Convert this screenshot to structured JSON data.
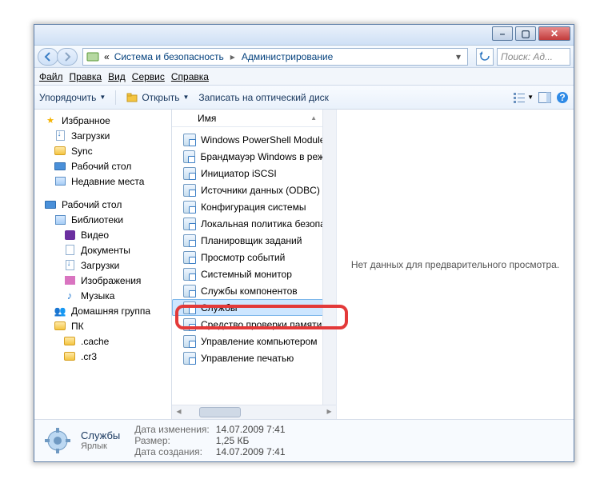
{
  "breadcrumb": {
    "level1": "Система и безопасность",
    "level2": "Администрирование"
  },
  "search": {
    "placeholder": "Поиск: Ад..."
  },
  "menu": {
    "file": "Файл",
    "edit": "Правка",
    "view": "Вид",
    "tools": "Сервис",
    "help": "Справка"
  },
  "toolbar": {
    "organize": "Упорядочить",
    "open": "Открыть",
    "burn": "Записать на оптический диск"
  },
  "nav": {
    "favorites": "Избранное",
    "downloads": "Загрузки",
    "sync": "Sync",
    "desktop": "Рабочий стол",
    "recent": "Недавние места",
    "desktop2": "Рабочий стол",
    "libraries": "Библиотеки",
    "videos": "Видео",
    "documents": "Документы",
    "downloads2": "Загрузки",
    "pictures": "Изображения",
    "music": "Музыка",
    "homegroup": "Домашняя группа",
    "pc": "ПК",
    "cache": ".cache",
    "cr3": ".cr3"
  },
  "col": {
    "name": "Имя"
  },
  "items": [
    "Windows PowerShell Modules",
    "Брандмауэр Windows в режим",
    "Инициатор iSCSI",
    "Источники данных (ODBC)",
    "Конфигурация системы",
    "Локальная политика безопас",
    "Планировщик заданий",
    "Просмотр событий",
    "Системный монитор",
    "Службы компонентов",
    "Службы",
    "Средство проверки памяти W",
    "Управление компьютером",
    "Управление печатью"
  ],
  "preview": {
    "text": "Нет данных для предварительного просмотра."
  },
  "details": {
    "title": "Службы",
    "type": "Ярлык",
    "mod_lbl": "Дата изменения:",
    "mod_val": "14.07.2009 7:41",
    "size_lbl": "Размер:",
    "size_val": "1,25 КБ",
    "created_lbl": "Дата создания:",
    "created_val": "14.07.2009 7:41"
  }
}
